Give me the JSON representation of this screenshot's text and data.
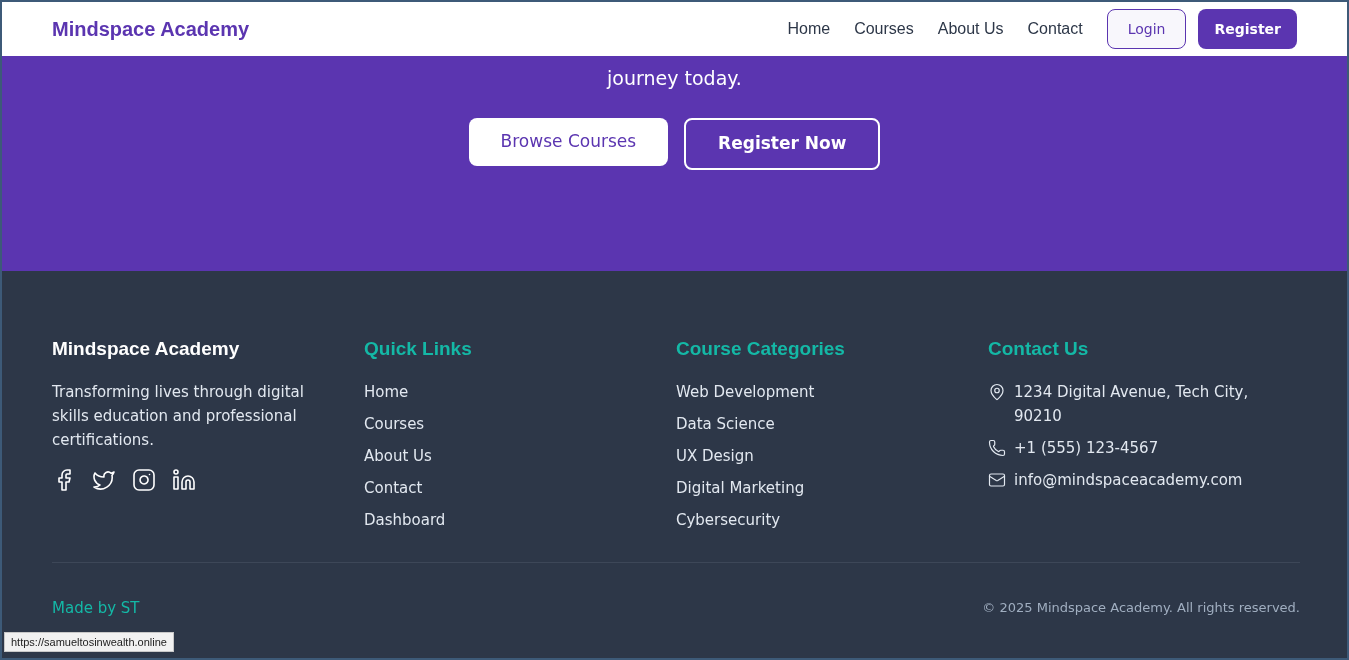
{
  "header": {
    "brand": "Mindspace Academy",
    "nav": [
      "Home",
      "Courses",
      "About Us",
      "Contact"
    ],
    "login": "Login",
    "register": "Register"
  },
  "hero": {
    "text": "journey today.",
    "buttons": [
      {
        "label": "Browse Courses",
        "kind": "solid"
      },
      {
        "label": "Register Now",
        "kind": "outline"
      }
    ]
  },
  "footer": {
    "brand": "Mindspace Academy",
    "tagline": "Transforming lives through digital skills education and professional certifications.",
    "social": [
      {
        "kind": "facebook"
      },
      {
        "kind": "twitter"
      },
      {
        "kind": "instagram"
      },
      {
        "kind": "linkedin"
      }
    ],
    "quick_links": {
      "title": "Quick Links",
      "items": [
        "Home",
        "Courses",
        "About Us",
        "Contact",
        "Dashboard"
      ]
    },
    "categories": {
      "title": "Course Categories",
      "items": [
        "Web Development",
        "Data Science",
        "UX Design",
        "Digital Marketing",
        "Cybersecurity"
      ]
    },
    "contact": {
      "title": "Contact Us",
      "items": [
        {
          "kind": "address",
          "text": "1234 Digital Avenue, Tech City, 90210"
        },
        {
          "kind": "phone",
          "text": "+1 (555) 123-4567"
        },
        {
          "kind": "email",
          "text": "info@mindspaceacademy.com"
        }
      ]
    },
    "made_by": "Made by ST",
    "copyright": "© 2025 Mindspace Academy. All rights reserved."
  },
  "status_bar": {
    "url": "https://samueltosinwealth.online"
  }
}
